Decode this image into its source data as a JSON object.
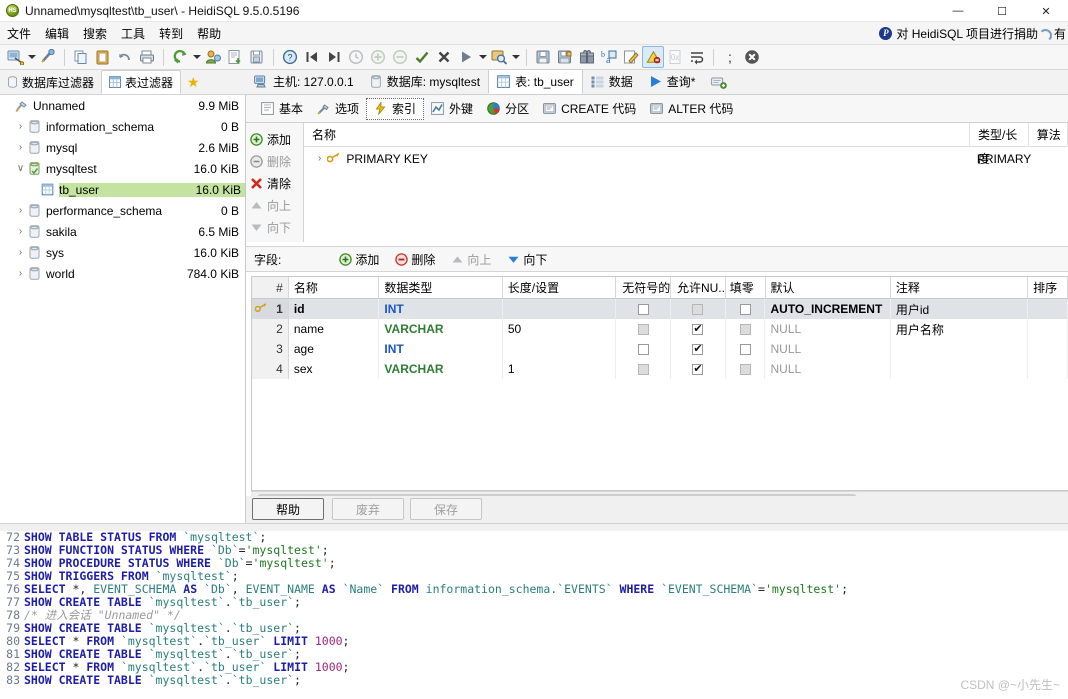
{
  "window": {
    "title": "Unnamed\\mysqltest\\tb_user\\ - HeidiSQL 9.5.0.5196",
    "logo_text": "HS",
    "minimize": "—",
    "maximize": "☐",
    "close": "✕"
  },
  "menu": {
    "items": [
      "文件",
      "编辑",
      "搜索",
      "工具",
      "转到",
      "帮助"
    ],
    "donate_text": "对 HeidiSQL 项目进行捐助",
    "paypal_label": "P",
    "right_text": "有"
  },
  "toolbar": {
    "groups": [
      [
        "session-manager-icon",
        "session-dropdown",
        "new-session-icon"
      ],
      [
        "copy-icon",
        "paste-icon",
        "undo-icon",
        "print-icon"
      ],
      [
        "refresh-icon",
        "refresh-dropdown",
        "user-manager-icon",
        "export-grid-icon",
        "import-icon"
      ],
      [
        "help-icon",
        "first-page-icon",
        "last-page-icon",
        "clock-icon"
      ],
      [
        "add-icon",
        "remove-icon",
        "apply-icon",
        "cancel-icon",
        "execute-icon",
        "execute-dropdown",
        "find-icon",
        "find-dropdown"
      ],
      [
        "save-icon",
        "save-as-icon",
        "gift-icon",
        "format-icon",
        "edit-icon",
        "stop-warning-icon",
        "blank-icon",
        "wrap-icon"
      ],
      [
        "semicolon-icon",
        "close-query-icon"
      ]
    ]
  },
  "left_panel": {
    "filter_tabs": [
      {
        "label": "数据库过滤器",
        "icon": "database-filter-icon",
        "active": false
      },
      {
        "label": "表过滤器",
        "icon": "table-filter-icon",
        "active": true
      }
    ],
    "favorite_icon": "star-icon",
    "tree": [
      {
        "label": "Unnamed",
        "size": "9.9 MiB",
        "indent": 0,
        "expander": "",
        "icon": "connection-icon",
        "selected": false
      },
      {
        "label": "information_schema",
        "size": "0 B",
        "indent": 1,
        "expander": "›",
        "icon": "database-icon",
        "selected": false
      },
      {
        "label": "mysql",
        "size": "2.6 MiB",
        "indent": 1,
        "expander": "›",
        "icon": "database-icon",
        "selected": false
      },
      {
        "label": "mysqltest",
        "size": "16.0 KiB",
        "indent": 1,
        "expander": "∨",
        "icon": "database-active-icon",
        "selected": false
      },
      {
        "label": "tb_user",
        "size": "16.0 KiB",
        "indent": 2,
        "expander": "",
        "icon": "table-icon",
        "selected": true
      },
      {
        "label": "performance_schema",
        "size": "0 B",
        "indent": 1,
        "expander": "›",
        "icon": "database-icon",
        "selected": false
      },
      {
        "label": "sakila",
        "size": "6.5 MiB",
        "indent": 1,
        "expander": "›",
        "icon": "database-icon",
        "selected": false
      },
      {
        "label": "sys",
        "size": "16.0 KiB",
        "indent": 1,
        "expander": "›",
        "icon": "database-icon",
        "selected": false
      },
      {
        "label": "world",
        "size": "784.0 KiB",
        "indent": 1,
        "expander": "›",
        "icon": "database-icon",
        "selected": false
      }
    ]
  },
  "main_tabs": [
    {
      "label": "主机: 127.0.0.1",
      "icon": "host-icon",
      "active": false
    },
    {
      "label": "数据库: mysqltest",
      "icon": "database-icon",
      "active": false
    },
    {
      "label": "表: tb_user",
      "icon": "table-icon",
      "active": true
    },
    {
      "label": "数据",
      "icon": "data-icon",
      "active": false
    },
    {
      "label": "查询*",
      "icon": "query-run-icon",
      "active": false
    },
    {
      "label": "",
      "icon": "new-query-tab-icon",
      "active": false
    }
  ],
  "sub_tabs": [
    {
      "label": "基本",
      "icon": "basic-icon",
      "active": false
    },
    {
      "label": "选项",
      "icon": "options-wrench-icon",
      "active": false
    },
    {
      "label": "索引",
      "icon": "index-lightning-icon",
      "active": true
    },
    {
      "label": "外键",
      "icon": "foreign-key-icon",
      "active": false
    },
    {
      "label": "分区",
      "icon": "partition-pie-icon",
      "active": false
    },
    {
      "label": "CREATE 代码",
      "icon": "create-code-icon",
      "active": false
    },
    {
      "label": "ALTER 代码",
      "icon": "alter-code-icon",
      "active": false
    }
  ],
  "index_panel": {
    "buttons": [
      {
        "label": "添加",
        "icon": "add-circle-icon",
        "disabled": false
      },
      {
        "label": "删除",
        "icon": "remove-circle-icon",
        "disabled": true
      },
      {
        "label": "清除",
        "icon": "clear-x-icon",
        "disabled": false
      },
      {
        "label": "向上",
        "icon": "move-up-icon",
        "disabled": true
      },
      {
        "label": "向下",
        "icon": "move-down-icon",
        "disabled": true
      }
    ],
    "columns": [
      "名称",
      "类型/长度",
      "算法"
    ],
    "rows": [
      {
        "expander": "›",
        "icon": "key-icon",
        "name": "PRIMARY KEY",
        "type_length": "PRIMARY",
        "algorithm": ""
      }
    ]
  },
  "fields_panel": {
    "title": "字段:",
    "buttons": [
      {
        "label": "添加",
        "icon": "add-circle-icon",
        "disabled": false
      },
      {
        "label": "删除",
        "icon": "remove-circle-icon",
        "disabled": false
      },
      {
        "label": "向上",
        "icon": "move-up-icon",
        "disabled": true
      },
      {
        "label": "向下",
        "icon": "move-down-icon",
        "disabled": false
      }
    ],
    "columns": [
      "#",
      "名称",
      "数据类型",
      "长度/设置",
      "无符号的",
      "允许NU...",
      "填零",
      "默认",
      "注释",
      "排序"
    ],
    "rows": [
      {
        "num": "1",
        "name": "id",
        "datatype": "INT",
        "dt_kind": "int",
        "length": "",
        "unsigned": "off",
        "allow_null": "gray",
        "zerofill": "off",
        "default": "AUTO_INCREMENT",
        "default_kind": "literal",
        "comment": "用户id",
        "collation": "",
        "selected": true,
        "key": true
      },
      {
        "num": "2",
        "name": "name",
        "datatype": "VARCHAR",
        "dt_kind": "varchar",
        "length": "50",
        "unsigned": "gray",
        "allow_null": "on",
        "zerofill": "gray",
        "default": "NULL",
        "default_kind": "null",
        "comment": "用户名称",
        "collation": "",
        "selected": false,
        "key": false
      },
      {
        "num": "3",
        "name": "age",
        "datatype": "INT",
        "dt_kind": "int",
        "length": "",
        "unsigned": "off",
        "allow_null": "on",
        "zerofill": "off",
        "default": "NULL",
        "default_kind": "null",
        "comment": "",
        "collation": "",
        "selected": false,
        "key": false
      },
      {
        "num": "4",
        "name": "sex",
        "datatype": "VARCHAR",
        "dt_kind": "varchar",
        "length": "1",
        "unsigned": "gray",
        "allow_null": "on",
        "zerofill": "gray",
        "default": "NULL",
        "default_kind": "null",
        "comment": "",
        "collation": "",
        "selected": false,
        "key": false
      }
    ]
  },
  "action_buttons": [
    {
      "label": "帮助",
      "style": "primary"
    },
    {
      "label": "废弃",
      "style": "disabled"
    },
    {
      "label": "保存",
      "style": "disabled"
    }
  ],
  "sql_log": {
    "lines": [
      {
        "num": "72",
        "tokens": [
          [
            "kw",
            "SHOW TABLE STATUS FROM "
          ],
          [
            "idq",
            "`mysqltest`"
          ],
          [
            "pl",
            ";"
          ]
        ]
      },
      {
        "num": "73",
        "tokens": [
          [
            "kw",
            "SHOW FUNCTION STATUS WHERE "
          ],
          [
            "idq",
            "`Db`"
          ],
          [
            "pl",
            "="
          ],
          [
            "str",
            "'mysqltest'"
          ],
          [
            "pl",
            ";"
          ]
        ]
      },
      {
        "num": "74",
        "tokens": [
          [
            "kw",
            "SHOW PROCEDURE STATUS WHERE "
          ],
          [
            "idq",
            "`Db`"
          ],
          [
            "pl",
            "="
          ],
          [
            "str",
            "'mysqltest'"
          ],
          [
            "pl",
            ";"
          ]
        ]
      },
      {
        "num": "75",
        "tokens": [
          [
            "kw",
            "SHOW TRIGGERS FROM "
          ],
          [
            "idq",
            "`mysqltest`"
          ],
          [
            "pl",
            ";"
          ]
        ]
      },
      {
        "num": "76",
        "tokens": [
          [
            "kw",
            "SELECT "
          ],
          [
            "pl",
            "*, "
          ],
          [
            "idq",
            "EVENT_SCHEMA"
          ],
          [
            "kw",
            " AS "
          ],
          [
            "idq",
            "`Db`"
          ],
          [
            "pl",
            ", "
          ],
          [
            "idq",
            "EVENT_NAME"
          ],
          [
            "kw",
            " AS "
          ],
          [
            "idq",
            "`Name`"
          ],
          [
            "kw",
            " FROM "
          ],
          [
            "idq",
            "information_schema.`EVENTS`"
          ],
          [
            "kw",
            " WHERE "
          ],
          [
            "idq",
            "`EVENT_SCHEMA`"
          ],
          [
            "pl",
            "="
          ],
          [
            "str",
            "'mysqltest'"
          ],
          [
            "pl",
            ";"
          ]
        ]
      },
      {
        "num": "77",
        "tokens": [
          [
            "kw",
            "SHOW CREATE TABLE "
          ],
          [
            "idq",
            "`mysqltest`"
          ],
          [
            "pl",
            "."
          ],
          [
            "idq",
            "`tb_user`"
          ],
          [
            "pl",
            ";"
          ]
        ]
      },
      {
        "num": "78",
        "tokens": [
          [
            "cmt",
            "/* 进入会话 \"Unnamed\" */"
          ]
        ]
      },
      {
        "num": "79",
        "tokens": [
          [
            "kw",
            "SHOW CREATE TABLE "
          ],
          [
            "idq",
            "`mysqltest`"
          ],
          [
            "pl",
            "."
          ],
          [
            "idq",
            "`tb_user`"
          ],
          [
            "pl",
            ";"
          ]
        ]
      },
      {
        "num": "80",
        "tokens": [
          [
            "kw",
            "SELECT "
          ],
          [
            "pl",
            "* "
          ],
          [
            "kw",
            "FROM "
          ],
          [
            "idq",
            "`mysqltest`"
          ],
          [
            "pl",
            "."
          ],
          [
            "idq",
            "`tb_user`"
          ],
          [
            "kw",
            " LIMIT "
          ],
          [
            "num",
            "1000"
          ],
          [
            "pl",
            ";"
          ]
        ]
      },
      {
        "num": "81",
        "tokens": [
          [
            "kw",
            "SHOW CREATE TABLE "
          ],
          [
            "idq",
            "`mysqltest`"
          ],
          [
            "pl",
            "."
          ],
          [
            "idq",
            "`tb_user`"
          ],
          [
            "pl",
            ";"
          ]
        ]
      },
      {
        "num": "82",
        "tokens": [
          [
            "kw",
            "SELECT "
          ],
          [
            "pl",
            "* "
          ],
          [
            "kw",
            "FROM "
          ],
          [
            "idq",
            "`mysqltest`"
          ],
          [
            "pl",
            "."
          ],
          [
            "idq",
            "`tb_user`"
          ],
          [
            "kw",
            " LIMIT "
          ],
          [
            "num",
            "1000"
          ],
          [
            "pl",
            ";"
          ]
        ]
      },
      {
        "num": "83",
        "tokens": [
          [
            "kw",
            "SHOW CREATE TABLE "
          ],
          [
            "idq",
            "`mysqltest`"
          ],
          [
            "pl",
            "."
          ],
          [
            "idq",
            "`tb_user`"
          ],
          [
            "pl",
            ";"
          ]
        ]
      }
    ],
    "watermark": "CSDN @~小先生~"
  },
  "colors": {
    "selection_green": "#c4e3a0",
    "row_selection": "#dfe3e8",
    "keyword_blue": "#1d1da8",
    "string_green": "#1f7a1f",
    "identifier_teal": "#2a7e7e",
    "int_blue": "#1b56c4",
    "varchar_green": "#2f7d32"
  }
}
